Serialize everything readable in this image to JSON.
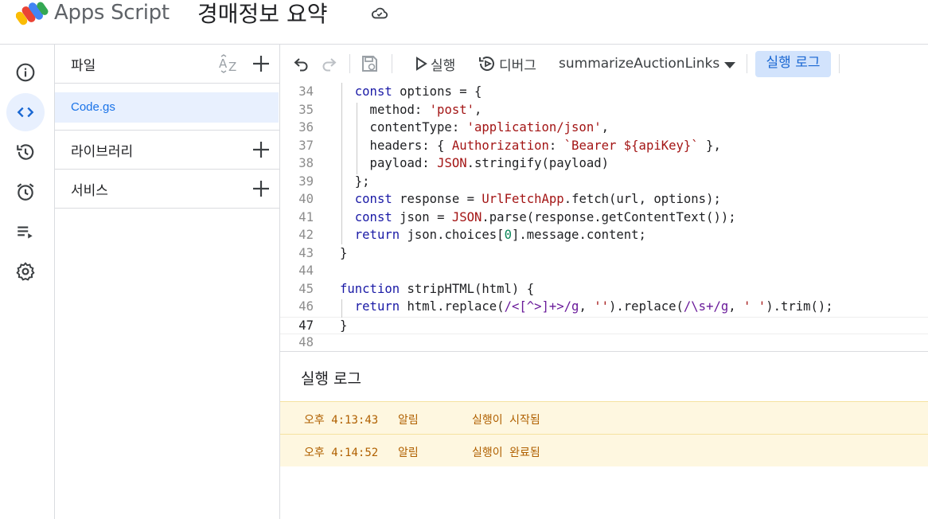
{
  "header": {
    "app_name": "Apps Script",
    "project_title": "경매정보 요약"
  },
  "files_panel": {
    "files_label": "파일",
    "files": [
      {
        "name": "Code.gs"
      }
    ],
    "libraries_label": "라이브러리",
    "services_label": "서비스"
  },
  "toolbar": {
    "run_label": "실행",
    "debug_label": "디버그",
    "function_name": "summarizeAuctionLinks",
    "log_label": "실행 로그"
  },
  "editor": {
    "current_line": 47,
    "lines": [
      {
        "n": "34",
        "text": "  const options = {"
      },
      {
        "n": "35",
        "text": "    method: 'post',"
      },
      {
        "n": "36",
        "text": "    contentType: 'application/json',"
      },
      {
        "n": "37",
        "text": "    headers: { Authorization: `Bearer ${apiKey}` },"
      },
      {
        "n": "38",
        "text": "    payload: JSON.stringify(payload)"
      },
      {
        "n": "39",
        "text": "  };"
      },
      {
        "n": "40",
        "text": "  const response = UrlFetchApp.fetch(url, options);"
      },
      {
        "n": "41",
        "text": "  const json = JSON.parse(response.getContentText());"
      },
      {
        "n": "42",
        "text": "  return json.choices[0].message.content;"
      },
      {
        "n": "43",
        "text": "}"
      },
      {
        "n": "44",
        "text": ""
      },
      {
        "n": "45",
        "text": "function stripHTML(html) {"
      },
      {
        "n": "46",
        "text": "  return html.replace(/<[^>]+>/g, '').replace(/\\s+/g, ' ').trim();"
      },
      {
        "n": "47",
        "text": "}"
      },
      {
        "n": "48",
        "text": ""
      }
    ]
  },
  "execution_log": {
    "title": "실행 로그",
    "entries": [
      {
        "time": "오후 4:13:43",
        "level": "알림",
        "message": "실행이 시작됨"
      },
      {
        "time": "오후 4:14:52",
        "level": "알림",
        "message": "실행이 완료됨"
      }
    ]
  },
  "colors": {
    "accent": "#1a73e8",
    "active_bg": "#e8f0fe",
    "log_bg": "#fef7e0",
    "log_text": "#b06000"
  }
}
